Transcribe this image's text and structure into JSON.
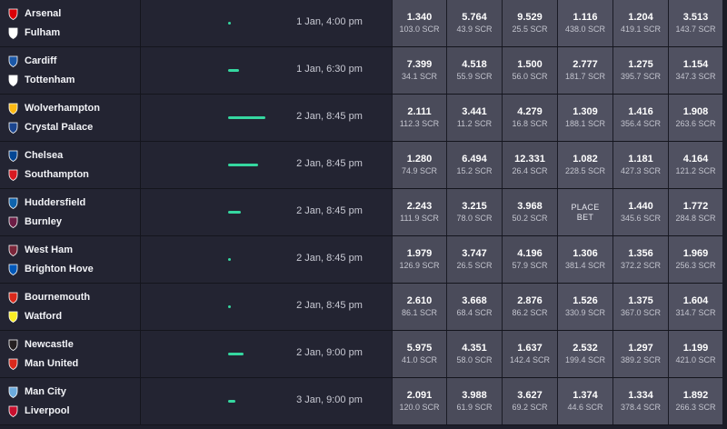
{
  "events": [
    {
      "home": {
        "name": "Arsenal",
        "crest": "arsenal-crest-icon",
        "color": "#db0007"
      },
      "away": {
        "name": "Fulham",
        "crest": "fulham-crest-icon",
        "color": "#ffffff"
      },
      "matched": "221 SCR",
      "matched_share": 0.0,
      "kickoff": "1 Jan, 4:00 pm",
      "odds": [
        {
          "price": "1.340",
          "liquidity": "103.0 SCR"
        },
        {
          "price": "5.764",
          "liquidity": "43.9 SCR"
        },
        {
          "price": "9.529",
          "liquidity": "25.5 SCR"
        },
        {
          "price": "1.116",
          "liquidity": "438.0 SCR"
        },
        {
          "price": "1.204",
          "liquidity": "419.1 SCR"
        },
        {
          "price": "3.513",
          "liquidity": "143.7 SCR"
        }
      ]
    },
    {
      "home": {
        "name": "Cardiff",
        "crest": "cardiff-crest-icon",
        "color": "#1b58a8"
      },
      "away": {
        "name": "Tottenham",
        "crest": "tottenham-crest-icon",
        "color": "#ffffff"
      },
      "matched": "913 SCR",
      "matched_share": 0.29,
      "kickoff": "1 Jan, 6:30 pm",
      "odds": [
        {
          "price": "7.399",
          "liquidity": "34.1 SCR"
        },
        {
          "price": "4.518",
          "liquidity": "55.9 SCR"
        },
        {
          "price": "1.500",
          "liquidity": "56.0 SCR"
        },
        {
          "price": "2.777",
          "liquidity": "181.7 SCR"
        },
        {
          "price": "1.275",
          "liquidity": "395.7 SCR"
        },
        {
          "price": "1.154",
          "liquidity": "347.3 SCR"
        }
      ]
    },
    {
      "home": {
        "name": "Wolverhampton",
        "crest": "wolves-crest-icon",
        "color": "#fdb913"
      },
      "away": {
        "name": "Crystal Palace",
        "crest": "crystal-palace-crest-icon",
        "color": "#1b458f"
      },
      "matched": "3,158 SCR",
      "matched_share": 1.0,
      "kickoff": "2 Jan, 8:45 pm",
      "odds": [
        {
          "price": "2.111",
          "liquidity": "112.3 SCR"
        },
        {
          "price": "3.441",
          "liquidity": "11.2 SCR"
        },
        {
          "price": "4.279",
          "liquidity": "16.8 SCR"
        },
        {
          "price": "1.309",
          "liquidity": "188.1 SCR"
        },
        {
          "price": "1.416",
          "liquidity": "356.4 SCR"
        },
        {
          "price": "1.908",
          "liquidity": "263.6 SCR"
        }
      ]
    },
    {
      "home": {
        "name": "Chelsea",
        "crest": "chelsea-crest-icon",
        "color": "#034694"
      },
      "away": {
        "name": "Southampton",
        "crest": "southampton-crest-icon",
        "color": "#d71920"
      },
      "matched": "2,540 SCR",
      "matched_share": 0.8,
      "kickoff": "2 Jan, 8:45 pm",
      "odds": [
        {
          "price": "1.280",
          "liquidity": "74.9 SCR"
        },
        {
          "price": "6.494",
          "liquidity": "15.2 SCR"
        },
        {
          "price": "12.331",
          "liquidity": "26.4 SCR"
        },
        {
          "price": "1.082",
          "liquidity": "228.5 SCR"
        },
        {
          "price": "1.181",
          "liquidity": "427.3 SCR"
        },
        {
          "price": "4.164",
          "liquidity": "121.2 SCR"
        }
      ]
    },
    {
      "home": {
        "name": "Huddersfield",
        "crest": "huddersfield-crest-icon",
        "color": "#0e63ad"
      },
      "away": {
        "name": "Burnley",
        "crest": "burnley-crest-icon",
        "color": "#6c1d45"
      },
      "matched": "1,073 SCR",
      "matched_share": 0.34,
      "kickoff": "2 Jan, 8:45 pm",
      "odds": [
        {
          "price": "2.243",
          "liquidity": "111.9 SCR"
        },
        {
          "price": "3.215",
          "liquidity": "78.0 SCR"
        },
        {
          "price": "3.968",
          "liquidity": "50.2 SCR"
        },
        {
          "place": [
            "PLACE",
            "BET"
          ]
        },
        {
          "price": "1.440",
          "liquidity": "345.6 SCR"
        },
        {
          "price": "1.772",
          "liquidity": "284.8 SCR"
        }
      ]
    },
    {
      "home": {
        "name": "West Ham",
        "crest": "west-ham-crest-icon",
        "color": "#7a263a"
      },
      "away": {
        "name": "Brighton Hove",
        "crest": "brighton-crest-icon",
        "color": "#0057b8"
      },
      "matched": "34 SCR",
      "matched_share": 0.0,
      "kickoff": "2 Jan, 8:45 pm",
      "odds": [
        {
          "price": "1.979",
          "liquidity": "126.9 SCR"
        },
        {
          "price": "3.747",
          "liquidity": "26.5 SCR"
        },
        {
          "price": "4.196",
          "liquidity": "57.9 SCR"
        },
        {
          "price": "1.306",
          "liquidity": "381.4 SCR"
        },
        {
          "price": "1.356",
          "liquidity": "372.2 SCR"
        },
        {
          "price": "1.969",
          "liquidity": "256.3 SCR"
        }
      ]
    },
    {
      "home": {
        "name": "Bournemouth",
        "crest": "bournemouth-crest-icon",
        "color": "#da291c"
      },
      "away": {
        "name": "Watford",
        "crest": "watford-crest-icon",
        "color": "#fbee23"
      },
      "matched": "36 SCR",
      "matched_share": 0.0,
      "kickoff": "2 Jan, 8:45 pm",
      "odds": [
        {
          "price": "2.610",
          "liquidity": "86.1 SCR"
        },
        {
          "price": "3.668",
          "liquidity": "68.4 SCR"
        },
        {
          "price": "2.876",
          "liquidity": "86.2 SCR"
        },
        {
          "price": "1.526",
          "liquidity": "330.9 SCR"
        },
        {
          "price": "1.375",
          "liquidity": "367.0 SCR"
        },
        {
          "price": "1.604",
          "liquidity": "314.7 SCR"
        }
      ]
    },
    {
      "home": {
        "name": "Newcastle",
        "crest": "newcastle-crest-icon",
        "color": "#241f20"
      },
      "away": {
        "name": "Man United",
        "crest": "man-united-crest-icon",
        "color": "#da291c"
      },
      "matched": "1,320 SCR",
      "matched_share": 0.42,
      "kickoff": "2 Jan, 9:00 pm",
      "odds": [
        {
          "price": "5.975",
          "liquidity": "41.0 SCR"
        },
        {
          "price": "4.351",
          "liquidity": "58.0 SCR"
        },
        {
          "price": "1.637",
          "liquidity": "142.4 SCR"
        },
        {
          "price": "2.532",
          "liquidity": "199.4 SCR"
        },
        {
          "price": "1.297",
          "liquidity": "389.2 SCR"
        },
        {
          "price": "1.199",
          "liquidity": "421.0 SCR"
        }
      ]
    },
    {
      "home": {
        "name": "Man City",
        "crest": "man-city-crest-icon",
        "color": "#6cabdd"
      },
      "away": {
        "name": "Liverpool",
        "crest": "liverpool-crest-icon",
        "color": "#c8102e"
      },
      "matched": "474 SCR",
      "matched_share": 0.15,
      "kickoff": "3 Jan, 9:00 pm",
      "odds": [
        {
          "price": "2.091",
          "liquidity": "120.0 SCR"
        },
        {
          "price": "3.988",
          "liquidity": "61.9 SCR"
        },
        {
          "price": "3.627",
          "liquidity": "69.2 SCR"
        },
        {
          "price": "1.374",
          "liquidity": "44.6 SCR"
        },
        {
          "price": "1.334",
          "liquidity": "378.4 SCR"
        },
        {
          "price": "1.892",
          "liquidity": "266.3 SCR"
        }
      ]
    }
  ],
  "colors": {
    "matched_bar": "#35d7a0",
    "row_bg": "#232432",
    "odds_bg": "#505161"
  }
}
